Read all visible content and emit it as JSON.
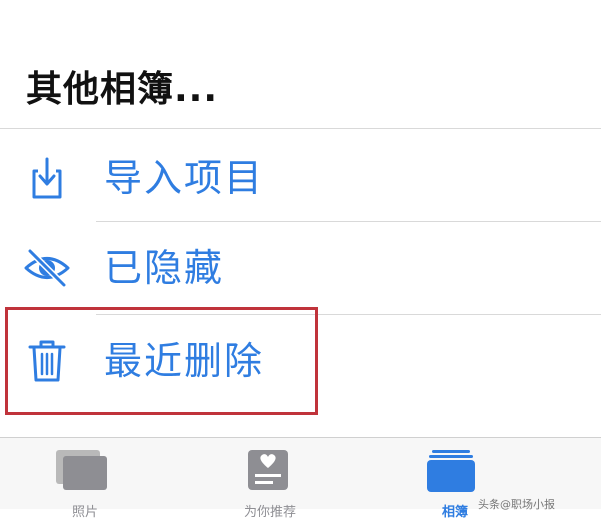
{
  "section": {
    "title": "其他相簿..."
  },
  "rows": [
    {
      "label": "导入项目",
      "icon": "import-icon"
    },
    {
      "label": "已隐藏",
      "icon": "hidden-eye-icon"
    },
    {
      "label": "最近删除",
      "icon": "trash-icon"
    }
  ],
  "tabbar": {
    "tabs": [
      {
        "label": "照片",
        "icon": "photos-icon",
        "active": false
      },
      {
        "label": "为你推荐",
        "icon": "for-you-icon",
        "active": false
      },
      {
        "label": "相簿",
        "icon": "albums-icon",
        "active": true
      }
    ]
  },
  "watermark": "头条@职场小报",
  "colors": {
    "accent": "#2f7de1",
    "highlight_border": "#c0333b",
    "divider": "#d9d9d9",
    "tab_inactive": "#8e8e93"
  }
}
